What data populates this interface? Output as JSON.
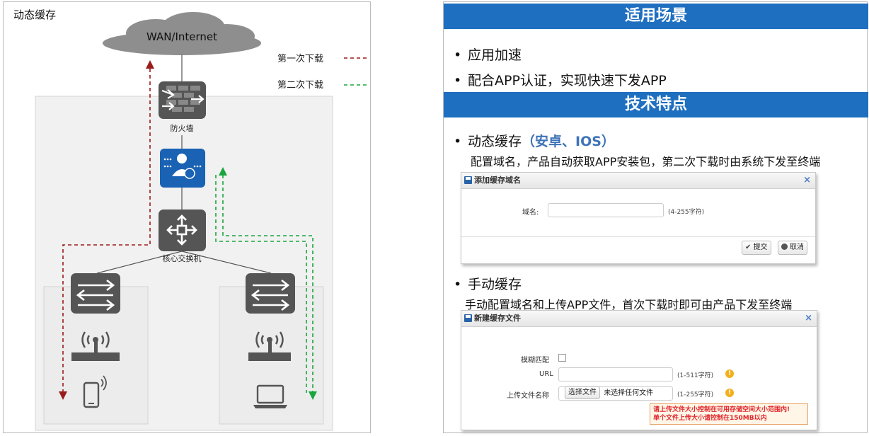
{
  "left": {
    "title": "动态缓存",
    "cloud_label": "WAN/Internet",
    "legend": {
      "first": "第一次下载",
      "second": "第二次下载",
      "first_color": "#9a1b1b",
      "second_color": "#1aa53d"
    },
    "devices": {
      "firewall": "防火墙",
      "core_switch": "核心交换机"
    },
    "icons": [
      "cloud-icon",
      "firewall-icon",
      "app-server-icon",
      "core-switch-icon",
      "access-switch-icon",
      "wireless-ap-icon",
      "mobile-phone-icon",
      "laptop-icon"
    ]
  },
  "right": {
    "banner1": "适用场景",
    "scenarios": [
      "应用加速",
      "配合APP认证，实现快速下发APP"
    ],
    "banner2": "技术特点",
    "feature1": {
      "title": "动态缓存",
      "highlight": "（安卓、IOS）",
      "desc": "配置域名，产品自动获取APP安装包，第二次下载时由系统下发至终端"
    },
    "dialog1": {
      "title": "添加缓存域名",
      "close": "×",
      "domain_label": "域名:",
      "domain_value": "",
      "domain_hint": "(4-255字符)",
      "submit": "提交",
      "cancel": "取消"
    },
    "feature2": {
      "title": "手动缓存",
      "desc": "手动配置域名和上传APP文件，首次下载时即可由产品下发至终端"
    },
    "dialog2": {
      "title": "新建缓存文件",
      "close": "×",
      "fuzzy_label": "模糊匹配",
      "url_label": "URL",
      "url_value": "",
      "url_hint": "(1-511字符)",
      "file_label": "上传文件名称",
      "choose_file": "选择文件",
      "no_file": "未选择任何文件",
      "file_hint": "(1-255字符)",
      "warn_glyph": "!",
      "error_line1": "请上传文件大小控制在可用存储空间大小范围内!",
      "error_line2": "单个文件上传大小请控制在150MB以内"
    },
    "accent": "#1f6fc0"
  }
}
